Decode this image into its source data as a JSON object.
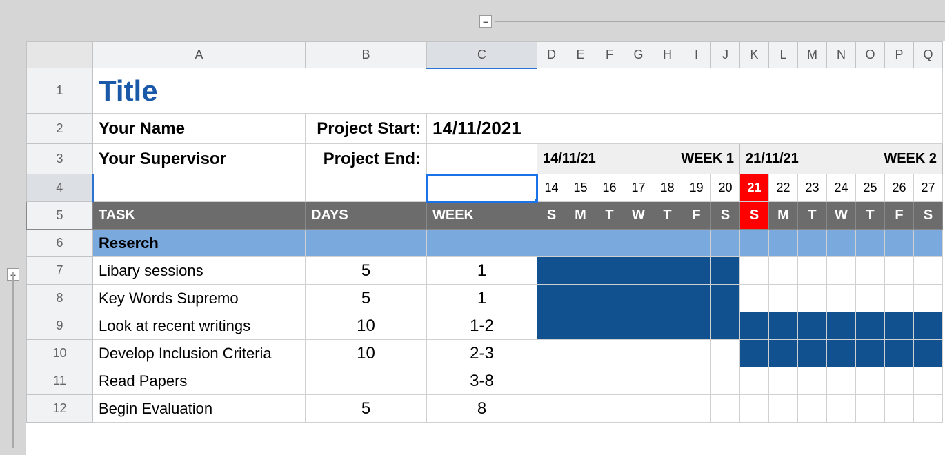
{
  "outline": {
    "collapse_symbol": "–"
  },
  "columns": [
    "",
    "A",
    "B",
    "C",
    "D",
    "E",
    "F",
    "G",
    "H",
    "I",
    "J",
    "K",
    "L",
    "M",
    "N",
    "O",
    "P",
    "Q"
  ],
  "rows": [
    "1",
    "2",
    "3",
    "4",
    "5",
    "6",
    "7",
    "8",
    "9",
    "10",
    "11",
    "12"
  ],
  "title": "Title",
  "name_label": "Your Name",
  "supervisor_label": "Your Supervisor",
  "project_start_label": "Project Start:",
  "project_end_label": "Project End:",
  "project_start_value": "14/11/2021",
  "weeks": [
    {
      "date": "14/11/21",
      "label": "WEEK 1",
      "days": [
        "14",
        "15",
        "16",
        "17",
        "18",
        "19",
        "20"
      ],
      "dow": [
        "S",
        "M",
        "T",
        "W",
        "T",
        "F",
        "S"
      ]
    },
    {
      "date": "21/11/21",
      "label": "WEEK 2",
      "days": [
        "21",
        "22",
        "23",
        "24",
        "25",
        "26",
        "27"
      ],
      "dow": [
        "S",
        "M",
        "T",
        "W",
        "T",
        "F",
        "S"
      ]
    }
  ],
  "today_day": "21",
  "headers": {
    "task": "TASK",
    "days": "DAYS",
    "week": "WEEK"
  },
  "section": "Reserch",
  "tasks": [
    {
      "name": "Libary sessions",
      "days": "5",
      "week": "1",
      "fill_start": 0,
      "fill_end": 6
    },
    {
      "name": "Key Words Supremo",
      "days": "5",
      "week": "1",
      "fill_start": 0,
      "fill_end": 6
    },
    {
      "name": "Look at recent writings",
      "days": "10",
      "week": "1-2",
      "fill_start": 0,
      "fill_end": 13
    },
    {
      "name": "Develop Inclusion Criteria",
      "days": "10",
      "week": "2-3",
      "fill_start": 7,
      "fill_end": 13
    },
    {
      "name": "Read Papers",
      "days": "",
      "week": "3-8",
      "fill_start": -1,
      "fill_end": -1
    },
    {
      "name": "Begin Evaluation",
      "days": "5",
      "week": "8",
      "fill_start": -1,
      "fill_end": -1
    }
  ]
}
